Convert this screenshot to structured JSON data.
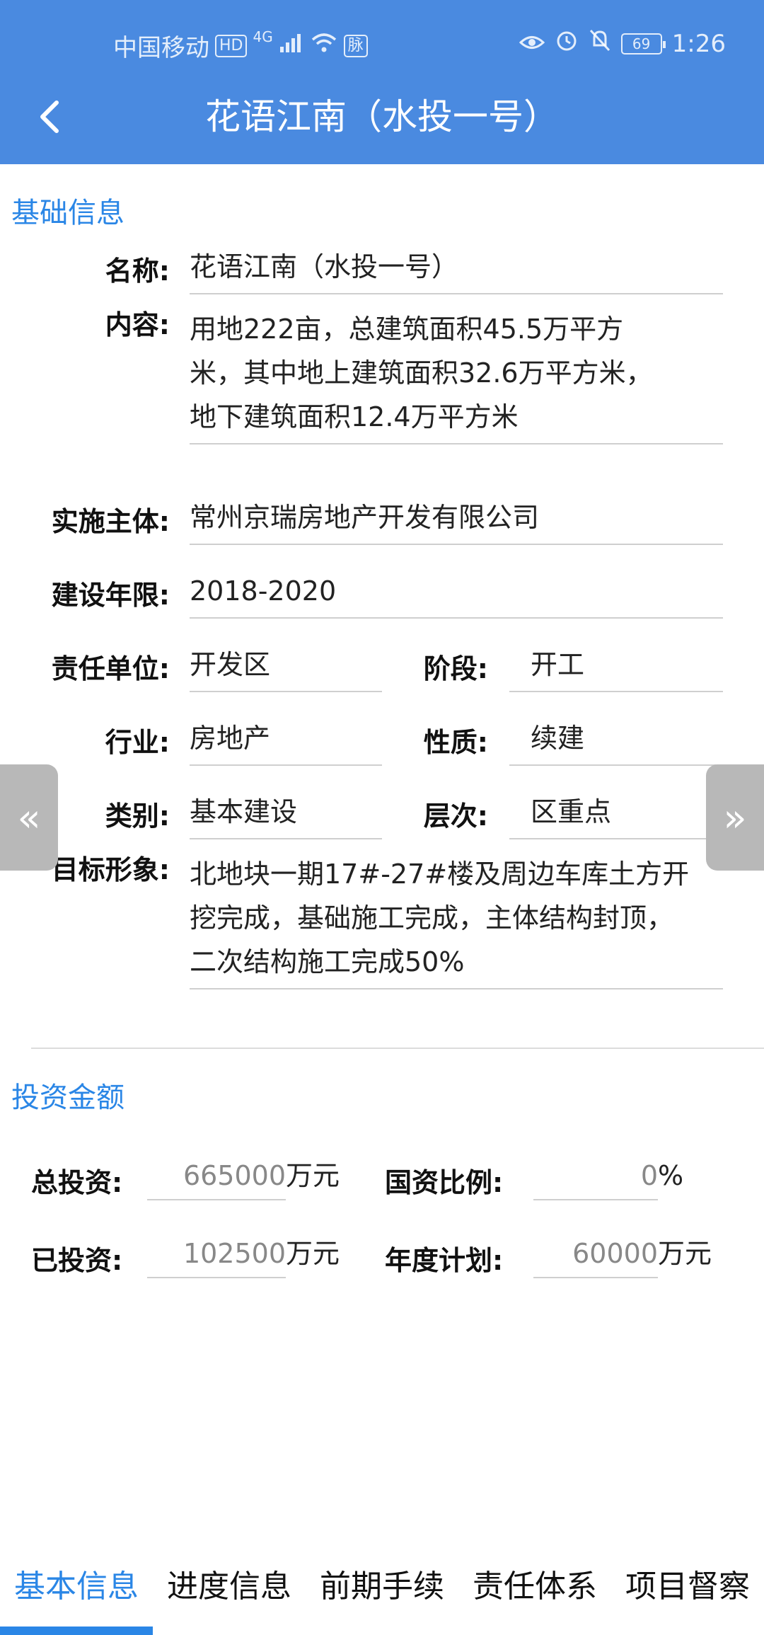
{
  "status_bar": {
    "carrier": "中国移动",
    "hd_badge": "HD",
    "network": "4G",
    "extra_badge": "脉",
    "battery": "69",
    "time": "1:26"
  },
  "header": {
    "title": "花语江南（水投一号）"
  },
  "basic_info": {
    "section_title": "基础信息",
    "name_label": "名称:",
    "name_value": "花语江南（水投一号）",
    "content_label": "内容:",
    "content_value": "用地222亩，总建筑面积45.5万平方米，其中地上建筑面积32.6万平方米，地下建筑面积12.4万平方米",
    "implementer_label": "实施主体:",
    "implementer_value": "常州京瑞房地产开发有限公司",
    "period_label": "建设年限:",
    "period_value": "2018-2020",
    "responsible_label": "责任单位:",
    "responsible_value": "开发区",
    "stage_label": "阶段:",
    "stage_value": "开工",
    "industry_label": "行业:",
    "industry_value": "房地产",
    "nature_label": "性质:",
    "nature_value": "续建",
    "category_label": "类别:",
    "category_value": "基本建设",
    "level_label": "层次:",
    "level_value": "区重点",
    "target_label": "目标形象:",
    "target_value": "北地块一期17#-27#楼及周边车库土方开挖完成，基础施工完成，主体结构封顶，二次结构施工完成50%"
  },
  "nav_arrows": {
    "prev": "«",
    "next": "»"
  },
  "investment": {
    "section_title": "投资金额",
    "total_label": "总投资:",
    "total_value": "665000",
    "total_unit": "万元",
    "state_ratio_label": "国资比例:",
    "state_ratio_value": "0",
    "state_ratio_unit": "%",
    "invested_label": "已投资:",
    "invested_value": "102500",
    "invested_unit": "万元",
    "annual_plan_label": "年度计划:",
    "annual_plan_value": "60000",
    "annual_plan_unit": "万元"
  },
  "tabs": [
    {
      "label": "基本信息"
    },
    {
      "label": "进度信息"
    },
    {
      "label": "前期手续"
    },
    {
      "label": "责任体系"
    },
    {
      "label": "项目督察"
    }
  ],
  "colors": {
    "appbar": "#4a8ae0",
    "accent": "#2a86e6"
  }
}
